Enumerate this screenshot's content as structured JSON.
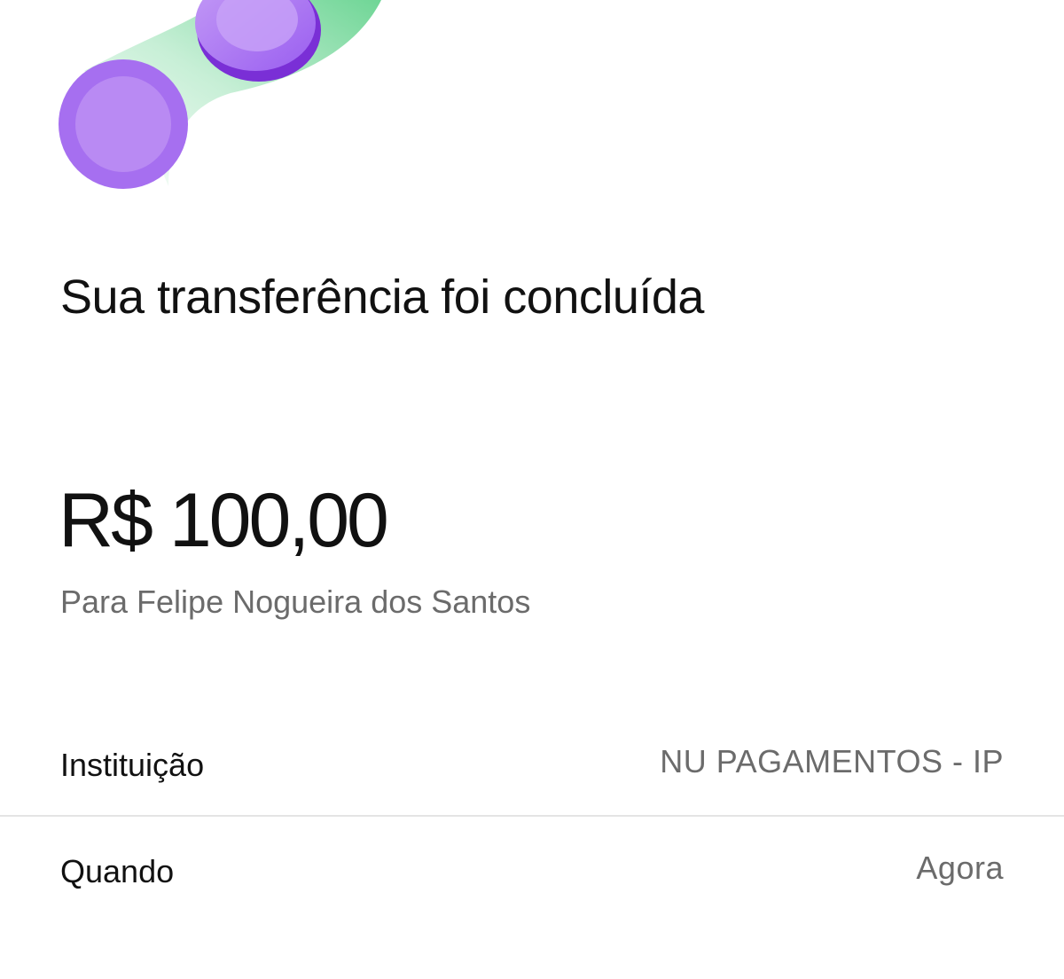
{
  "illustration": {
    "icon": "coins-transfer-illustration",
    "colors": {
      "coin": "#a66ff0",
      "coin_light": "#c49cf6",
      "coin_dark": "#7a2fd6",
      "trail": "#5fd18a"
    }
  },
  "receipt": {
    "title": "Sua transferência foi concluída",
    "amount": "R$ 100,00",
    "recipient": "Para Felipe Nogueira dos Santos"
  },
  "details": [
    {
      "label": "Instituição",
      "value": "NU PAGAMENTOS - IP"
    },
    {
      "label": "Quando",
      "value": "Agora"
    }
  ]
}
